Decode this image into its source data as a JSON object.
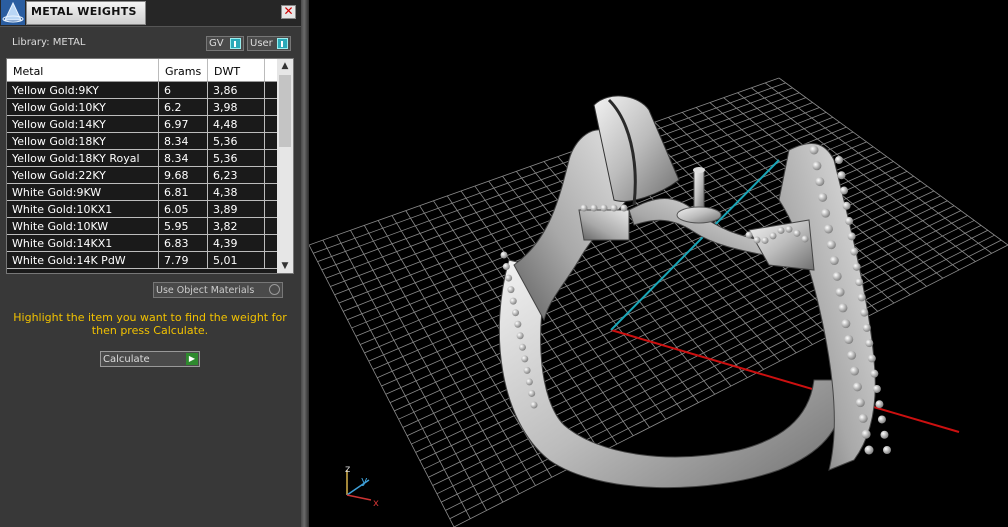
{
  "titlebar": {
    "title": "METAL WEIGHTS",
    "close_glyph": "✕"
  },
  "library": {
    "label": "Library: METAL"
  },
  "toggles": {
    "gv": "GV",
    "user": "User"
  },
  "table": {
    "headers": [
      "Metal",
      "Grams",
      "DWT"
    ],
    "rows": [
      [
        "Yellow Gold:9KY",
        "6",
        "3,86"
      ],
      [
        "Yellow Gold:10KY",
        "6.2",
        "3,98"
      ],
      [
        "Yellow Gold:14KY",
        "6.97",
        "4,48"
      ],
      [
        "Yellow Gold:18KY",
        "8.34",
        "5,36"
      ],
      [
        "Yellow Gold:18KY Royal",
        "8.34",
        "5,36"
      ],
      [
        "Yellow Gold:22KY",
        "9.68",
        "6,23"
      ],
      [
        "White Gold:9KW",
        "6.81",
        "4,38"
      ],
      [
        "White Gold:10KX1",
        "6.05",
        "3,89"
      ],
      [
        "White Gold:10KW",
        "5.95",
        "3,82"
      ],
      [
        "White Gold:14KX1",
        "6.83",
        "4,39"
      ],
      [
        "White Gold:14K PdW",
        "7.79",
        "5,01"
      ]
    ]
  },
  "use_object_materials": "Use Object Materials",
  "hint": "Highlight the item you want to find the weight for then press Calculate.",
  "calculate": "Calculate",
  "viewport": {
    "axis_z": "z",
    "axis_y": "y",
    "axis_x": "x",
    "colors": {
      "grid": "#8a8a8a",
      "x_axis": "#cc1010",
      "y_axis": "#1aa6b8",
      "hint": "#f2c200"
    }
  }
}
